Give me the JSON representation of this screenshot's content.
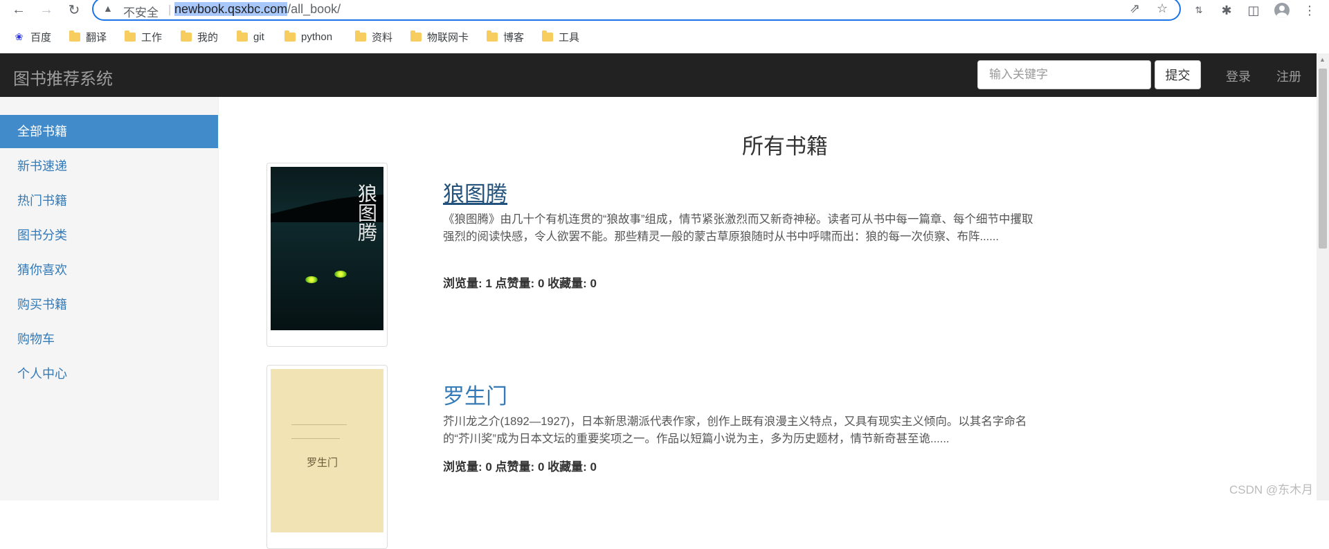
{
  "browser": {
    "not_secure": "不安全",
    "url_host": "newbook.qsxbc.com",
    "url_path": "/all_book/",
    "bookmarks": [
      "百度",
      "翻译",
      "工作",
      "我的",
      "git",
      "python",
      "资料",
      "物联网卡",
      "博客",
      "工具"
    ]
  },
  "site": {
    "brand": "图书推荐系统",
    "search_placeholder": "输入关键字",
    "submit_label": "提交",
    "login": "登录",
    "register": "注册"
  },
  "sidebar": {
    "items": [
      {
        "label": "全部书籍",
        "active": true
      },
      {
        "label": "新书速递",
        "active": false
      },
      {
        "label": "热门书籍",
        "active": false
      },
      {
        "label": "图书分类",
        "active": false
      },
      {
        "label": "猜你喜欢",
        "active": false
      },
      {
        "label": "购买书籍",
        "active": false
      },
      {
        "label": "购物车",
        "active": false
      },
      {
        "label": "个人中心",
        "active": false
      }
    ]
  },
  "main": {
    "title": "所有书籍",
    "books": [
      {
        "title": "狼图腾",
        "cover_text": "狼图腾",
        "desc": "《狼图腾》由几十个有机连贯的“狼故事”组成，情节紧张激烈而又新奇神秘。读者可从书中每一篇章、每个细节中攫取强烈的阅读快感，令人欲罢不能。那些精灵一般的蒙古草原狼随时从书中呼啸而出：狼的每一次侦察、布阵......",
        "stats": "浏览量: 1 点赞量: 0 收藏量: 0"
      },
      {
        "title": "罗生门",
        "cover_text": "罗生门",
        "desc": "芥川龙之介(1892—1927)，日本新思潮派代表作家，创作上既有浪漫主义特点，又具有现实主义倾向。以其名字命名的“芥川奖”成为日本文坛的重要奖项之一。作品以短篇小说为主，多为历史题材，情节新奇甚至诡......",
        "stats": "浏览量: 0 点赞量: 0 收藏量: 0"
      }
    ]
  },
  "watermark": "CSDN @东木月"
}
